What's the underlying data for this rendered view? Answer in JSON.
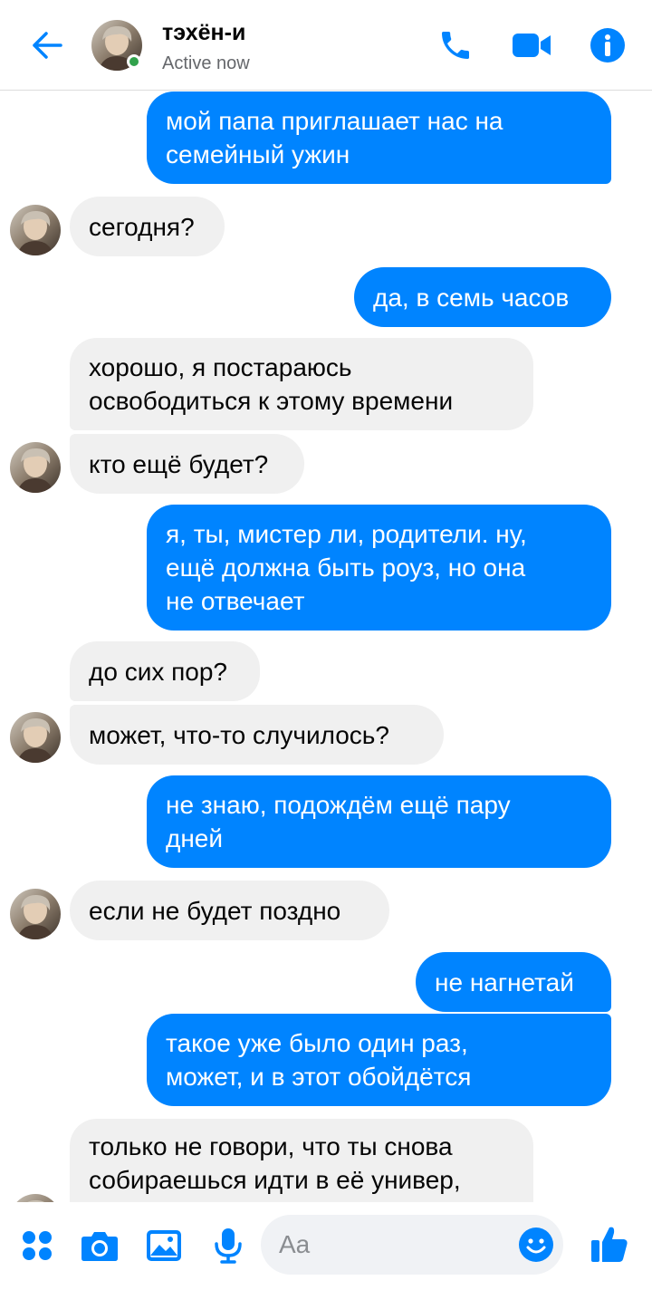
{
  "header": {
    "contact_name": "тэхён-и",
    "status": "Active now",
    "back_icon": "arrow-left-icon",
    "call_icon": "phone-icon",
    "video_icon": "video-camera-icon",
    "info_icon": "info-icon"
  },
  "colors": {
    "accent": "#0084ff",
    "outgoing_bubble": "#0084ff",
    "incoming_bubble": "#f0f0f0",
    "online": "#31a24c"
  },
  "messages": [
    {
      "dir": "out",
      "text": "мой папа приглашает нас на\nсемейный ужин"
    },
    {
      "dir": "in",
      "text": "сегодня?"
    },
    {
      "dir": "out",
      "text": "да, в семь часов"
    },
    {
      "dir": "in",
      "text": "хорошо, я постараюсь\nосвободиться к этому времени"
    },
    {
      "dir": "in",
      "text": "кто ещё будет?"
    },
    {
      "dir": "out",
      "text": "я, ты, мистер ли, родители. ну,\nещё должна быть роуз, но она\nне отвечает"
    },
    {
      "dir": "in",
      "text": "до сих пор?"
    },
    {
      "dir": "in",
      "text": "может, что-то случилось?"
    },
    {
      "dir": "out",
      "text": "не знаю, подождём ещё пару\nдней"
    },
    {
      "dir": "in",
      "text": "если не будет поздно"
    },
    {
      "dir": "out",
      "text": "не нагнетай"
    },
    {
      "dir": "out",
      "text": "такое уже было один раз,\nможет, и в этот обойдётся"
    },
    {
      "dir": "in",
      "text": "только не говори, что ты снова\nсобираешься идти в её универ,"
    }
  ],
  "composer": {
    "placeholder": "Aa",
    "more_icon": "four-dots-menu-icon",
    "camera_icon": "camera-icon",
    "gallery_icon": "image-icon",
    "mic_icon": "microphone-icon",
    "emoji_icon": "smiley-emoji-icon",
    "like_icon": "thumbs-up-icon"
  }
}
